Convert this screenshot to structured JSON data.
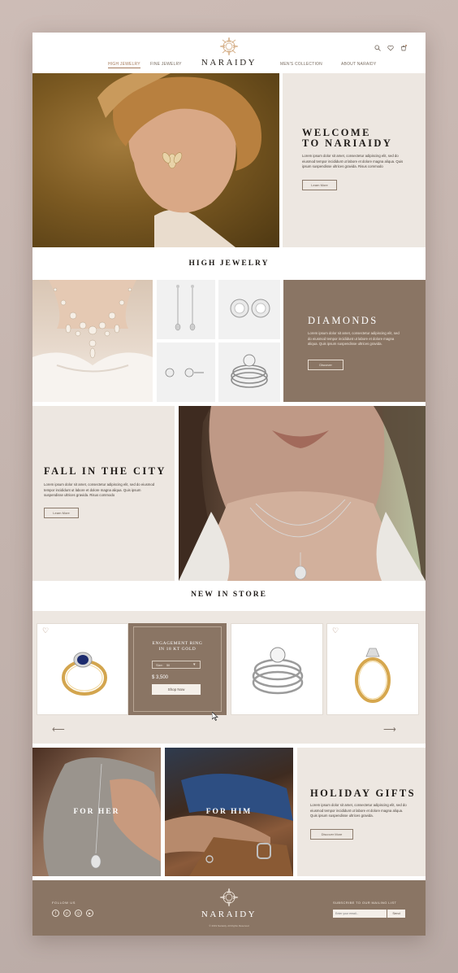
{
  "header": {
    "nav_left": [
      "HIGH JEWELRY",
      "FINE JEWELRY"
    ],
    "nav_right": [
      "MEN'S COLLECTION",
      "ABOUT NARAIDY"
    ],
    "brand": "NARAIDY",
    "icons": [
      "search-icon",
      "heart-icon",
      "cart-icon"
    ]
  },
  "hero": {
    "title_line1": "WELCOME",
    "title_line2": "TO NARIAIDY",
    "text": "Lorem ipsum dolor sit amet, consectetur adipiscing elit, sed do eiusmod tempor incididunt ut labore et dolore magna aliqua. Quis ipsum suspendisse ultrices gravida. Risus commodo",
    "button": "Learn More"
  },
  "high_jewelry": {
    "title": "HIGH JEWELRY",
    "diamonds_title": "DIAMONDS",
    "diamonds_text": "Lorem ipsum dolor sit amet, consectetur adipiscing elit, sed do eiusmod tempor incididunt ut labore et dolore magna aliqua. Quis ipsum suspendisse ultrices gravida.",
    "diamonds_button": "Discover"
  },
  "fall": {
    "title": "FALL IN THE CITY",
    "text": "Lorem ipsum dolor sit amet, consectetur adipiscing elit, sed do eiusmod tempor incididunt ut labore et dolore magna aliqua. Quis ipsum suspendisse ultrices gravida. Risus commodo",
    "button": "Learn More"
  },
  "new_in_store": {
    "title": "NEW IN STORE",
    "featured": {
      "name_line1": "ENGAGEMENT RING",
      "name_line2": "IN 18 KT GOLD",
      "size_label": "Size:",
      "size_value": "5ll",
      "price": "$ 3,500",
      "button": "Shop Now"
    }
  },
  "promo": {
    "for_her": "FOR HER",
    "for_him": "FOR HIM",
    "holiday_title": "HOLIDAY GIFTS",
    "holiday_text": "Lorem ipsum dolor sit amet, consectetur adipiscing elit, sed do eiusmod tempor incididunt ut labore et dolore magna aliqua. Quis ipsum suspendisse ultrices gravida.",
    "holiday_button": "Discover More"
  },
  "footer": {
    "follow": "FOLLOW US",
    "brand": "NARAIDY",
    "copyright": "© 2019 Nariaidy. All Rights Reserved",
    "subscribe": "SUBSCRIBE TO OUR MAILING LIST",
    "email_placeholder": "Enter your email...",
    "send": "Send",
    "social": [
      "facebook-icon",
      "pinterest-icon",
      "instagram-icon",
      "youtube-icon"
    ]
  },
  "colors": {
    "taupe": "#8a7564",
    "beige": "#ede7e1",
    "gold": "#c9a27a"
  }
}
